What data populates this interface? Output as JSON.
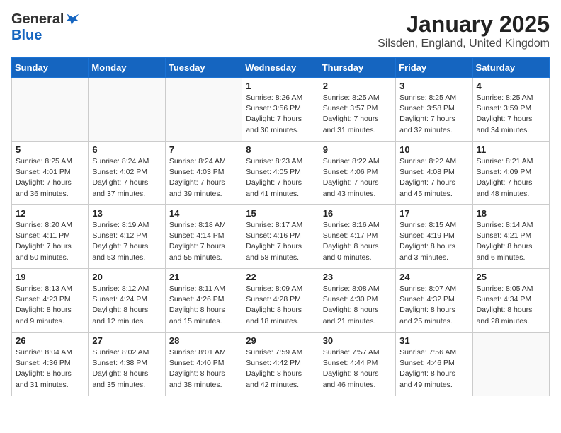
{
  "logo": {
    "general": "General",
    "blue": "Blue"
  },
  "title": "January 2025",
  "location": "Silsden, England, United Kingdom",
  "weekdays": [
    "Sunday",
    "Monday",
    "Tuesday",
    "Wednesday",
    "Thursday",
    "Friday",
    "Saturday"
  ],
  "weeks": [
    [
      {
        "day": "",
        "info": ""
      },
      {
        "day": "",
        "info": ""
      },
      {
        "day": "",
        "info": ""
      },
      {
        "day": "1",
        "info": "Sunrise: 8:26 AM\nSunset: 3:56 PM\nDaylight: 7 hours\nand 30 minutes."
      },
      {
        "day": "2",
        "info": "Sunrise: 8:25 AM\nSunset: 3:57 PM\nDaylight: 7 hours\nand 31 minutes."
      },
      {
        "day": "3",
        "info": "Sunrise: 8:25 AM\nSunset: 3:58 PM\nDaylight: 7 hours\nand 32 minutes."
      },
      {
        "day": "4",
        "info": "Sunrise: 8:25 AM\nSunset: 3:59 PM\nDaylight: 7 hours\nand 34 minutes."
      }
    ],
    [
      {
        "day": "5",
        "info": "Sunrise: 8:25 AM\nSunset: 4:01 PM\nDaylight: 7 hours\nand 36 minutes."
      },
      {
        "day": "6",
        "info": "Sunrise: 8:24 AM\nSunset: 4:02 PM\nDaylight: 7 hours\nand 37 minutes."
      },
      {
        "day": "7",
        "info": "Sunrise: 8:24 AM\nSunset: 4:03 PM\nDaylight: 7 hours\nand 39 minutes."
      },
      {
        "day": "8",
        "info": "Sunrise: 8:23 AM\nSunset: 4:05 PM\nDaylight: 7 hours\nand 41 minutes."
      },
      {
        "day": "9",
        "info": "Sunrise: 8:22 AM\nSunset: 4:06 PM\nDaylight: 7 hours\nand 43 minutes."
      },
      {
        "day": "10",
        "info": "Sunrise: 8:22 AM\nSunset: 4:08 PM\nDaylight: 7 hours\nand 45 minutes."
      },
      {
        "day": "11",
        "info": "Sunrise: 8:21 AM\nSunset: 4:09 PM\nDaylight: 7 hours\nand 48 minutes."
      }
    ],
    [
      {
        "day": "12",
        "info": "Sunrise: 8:20 AM\nSunset: 4:11 PM\nDaylight: 7 hours\nand 50 minutes."
      },
      {
        "day": "13",
        "info": "Sunrise: 8:19 AM\nSunset: 4:12 PM\nDaylight: 7 hours\nand 53 minutes."
      },
      {
        "day": "14",
        "info": "Sunrise: 8:18 AM\nSunset: 4:14 PM\nDaylight: 7 hours\nand 55 minutes."
      },
      {
        "day": "15",
        "info": "Sunrise: 8:17 AM\nSunset: 4:16 PM\nDaylight: 7 hours\nand 58 minutes."
      },
      {
        "day": "16",
        "info": "Sunrise: 8:16 AM\nSunset: 4:17 PM\nDaylight: 8 hours\nand 0 minutes."
      },
      {
        "day": "17",
        "info": "Sunrise: 8:15 AM\nSunset: 4:19 PM\nDaylight: 8 hours\nand 3 minutes."
      },
      {
        "day": "18",
        "info": "Sunrise: 8:14 AM\nSunset: 4:21 PM\nDaylight: 8 hours\nand 6 minutes."
      }
    ],
    [
      {
        "day": "19",
        "info": "Sunrise: 8:13 AM\nSunset: 4:23 PM\nDaylight: 8 hours\nand 9 minutes."
      },
      {
        "day": "20",
        "info": "Sunrise: 8:12 AM\nSunset: 4:24 PM\nDaylight: 8 hours\nand 12 minutes."
      },
      {
        "day": "21",
        "info": "Sunrise: 8:11 AM\nSunset: 4:26 PM\nDaylight: 8 hours\nand 15 minutes."
      },
      {
        "day": "22",
        "info": "Sunrise: 8:09 AM\nSunset: 4:28 PM\nDaylight: 8 hours\nand 18 minutes."
      },
      {
        "day": "23",
        "info": "Sunrise: 8:08 AM\nSunset: 4:30 PM\nDaylight: 8 hours\nand 21 minutes."
      },
      {
        "day": "24",
        "info": "Sunrise: 8:07 AM\nSunset: 4:32 PM\nDaylight: 8 hours\nand 25 minutes."
      },
      {
        "day": "25",
        "info": "Sunrise: 8:05 AM\nSunset: 4:34 PM\nDaylight: 8 hours\nand 28 minutes."
      }
    ],
    [
      {
        "day": "26",
        "info": "Sunrise: 8:04 AM\nSunset: 4:36 PM\nDaylight: 8 hours\nand 31 minutes."
      },
      {
        "day": "27",
        "info": "Sunrise: 8:02 AM\nSunset: 4:38 PM\nDaylight: 8 hours\nand 35 minutes."
      },
      {
        "day": "28",
        "info": "Sunrise: 8:01 AM\nSunset: 4:40 PM\nDaylight: 8 hours\nand 38 minutes."
      },
      {
        "day": "29",
        "info": "Sunrise: 7:59 AM\nSunset: 4:42 PM\nDaylight: 8 hours\nand 42 minutes."
      },
      {
        "day": "30",
        "info": "Sunrise: 7:57 AM\nSunset: 4:44 PM\nDaylight: 8 hours\nand 46 minutes."
      },
      {
        "day": "31",
        "info": "Sunrise: 7:56 AM\nSunset: 4:46 PM\nDaylight: 8 hours\nand 49 minutes."
      },
      {
        "day": "",
        "info": ""
      }
    ]
  ]
}
